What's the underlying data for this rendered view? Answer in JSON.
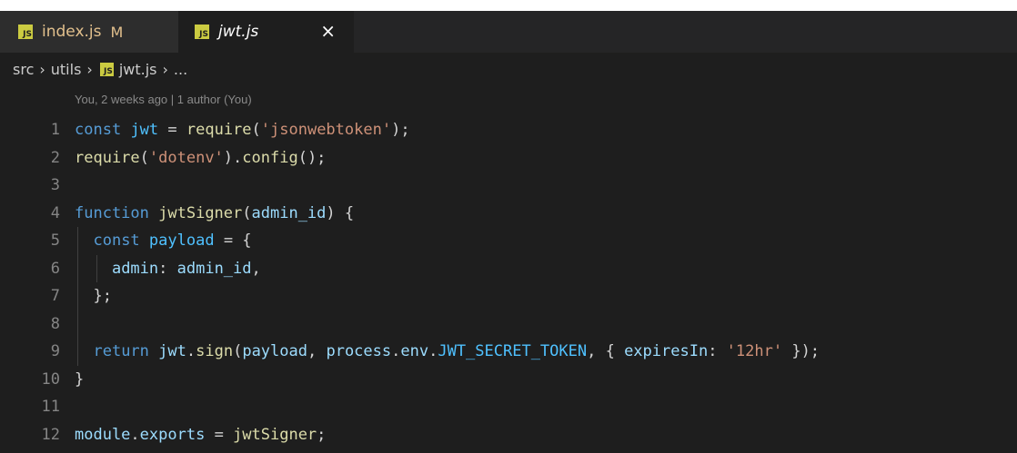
{
  "editor": {
    "tabs": [
      {
        "label": "index.js",
        "modified_marker": "M"
      },
      {
        "label": "jwt.js",
        "close_glyph": "×"
      }
    ],
    "breadcrumb": [
      "src",
      "utils",
      "jwt.js",
      "..."
    ],
    "blame": "You, 2 weeks ago | 1 author (You)",
    "lines": [
      {
        "n": "1",
        "tokens": [
          [
            "kw",
            "const"
          ],
          [
            "pu",
            " "
          ],
          [
            "cn",
            "jwt"
          ],
          [
            "pu",
            " = "
          ],
          [
            "fn",
            "require"
          ],
          [
            "pu",
            "("
          ],
          [
            "st",
            "'jsonwebtoken'"
          ],
          [
            "pu",
            ");"
          ]
        ]
      },
      {
        "n": "2",
        "tokens": [
          [
            "fn",
            "require"
          ],
          [
            "pu",
            "("
          ],
          [
            "st",
            "'dotenv'"
          ],
          [
            "pu",
            ")."
          ],
          [
            "fn",
            "config"
          ],
          [
            "pu",
            "();"
          ]
        ]
      },
      {
        "n": "3",
        "tokens": []
      },
      {
        "n": "4",
        "tokens": [
          [
            "kw",
            "function"
          ],
          [
            "pu",
            " "
          ],
          [
            "fn",
            "jwtSigner"
          ],
          [
            "pu",
            "("
          ],
          [
            "vr",
            "admin_id"
          ],
          [
            "pu",
            ") {"
          ]
        ]
      },
      {
        "n": "5",
        "tokens": [
          [
            "pu",
            "  "
          ],
          [
            "kw",
            "const"
          ],
          [
            "pu",
            " "
          ],
          [
            "cn",
            "payload"
          ],
          [
            "pu",
            " = {"
          ]
        ]
      },
      {
        "n": "6",
        "tokens": [
          [
            "pu",
            "    "
          ],
          [
            "vr",
            "admin"
          ],
          [
            "pu",
            ": "
          ],
          [
            "vr",
            "admin_id"
          ],
          [
            "pu",
            ","
          ]
        ]
      },
      {
        "n": "7",
        "tokens": [
          [
            "pu",
            "  };"
          ]
        ]
      },
      {
        "n": "8",
        "tokens": []
      },
      {
        "n": "9",
        "tokens": [
          [
            "pu",
            "  "
          ],
          [
            "kw",
            "return"
          ],
          [
            "pu",
            " "
          ],
          [
            "vr",
            "jwt"
          ],
          [
            "pu",
            "."
          ],
          [
            "fn",
            "sign"
          ],
          [
            "pu",
            "("
          ],
          [
            "vr",
            "payload"
          ],
          [
            "pu",
            ", "
          ],
          [
            "vr",
            "process"
          ],
          [
            "pu",
            "."
          ],
          [
            "vr",
            "env"
          ],
          [
            "pu",
            "."
          ],
          [
            "cn",
            "JWT_SECRET_TOKEN"
          ],
          [
            "pu",
            ", { "
          ],
          [
            "vr",
            "expiresIn"
          ],
          [
            "pu",
            ": "
          ],
          [
            "st",
            "'12hr'"
          ],
          [
            "pu",
            " });"
          ]
        ]
      },
      {
        "n": "10",
        "tokens": [
          [
            "pu",
            "}"
          ]
        ]
      },
      {
        "n": "11",
        "tokens": []
      },
      {
        "n": "12",
        "tokens": [
          [
            "vr",
            "module"
          ],
          [
            "pu",
            "."
          ],
          [
            "vr",
            "exports"
          ],
          [
            "pu",
            " = "
          ],
          [
            "fn",
            "jwtSigner"
          ],
          [
            "pu",
            ";"
          ]
        ]
      }
    ]
  },
  "colors": {
    "background": "#1e1e1e",
    "keyword": "#569cd6",
    "string": "#ce9178",
    "function": "#dcdcaa",
    "variable": "#9cdcfe",
    "constant": "#4fc1ff",
    "js_icon": "#cbcb41"
  },
  "icons": {
    "file_icon": "javascript-file-icon",
    "close": "close-icon",
    "separator": "chevron-right-icon"
  }
}
